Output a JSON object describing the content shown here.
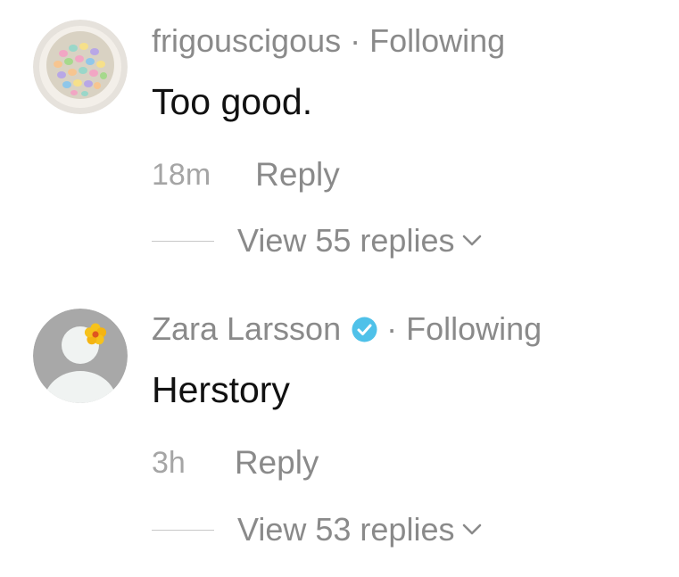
{
  "comments": [
    {
      "username": "frigouscigous",
      "separator": "·",
      "follow_status": "Following",
      "text": "Too good.",
      "timestamp": "18m",
      "reply_label": "Reply",
      "view_replies_label": "View 55 replies",
      "avatar": "candy-bowl-photo",
      "verified": false
    },
    {
      "username": "Zara Larsson",
      "separator": "·",
      "follow_status": "Following",
      "text": "Herstory",
      "timestamp": "3h",
      "reply_label": "Reply",
      "view_replies_label": "View 53 replies",
      "avatar": "default-avatar-with-flower",
      "verified": true
    }
  ],
  "colors": {
    "meta_text": "#8a8a8a",
    "body_text": "#111111",
    "verified_badge": "#4fc1e9"
  },
  "icons": {
    "verified": "verified-badge-icon",
    "expand": "chevron-down-icon"
  }
}
